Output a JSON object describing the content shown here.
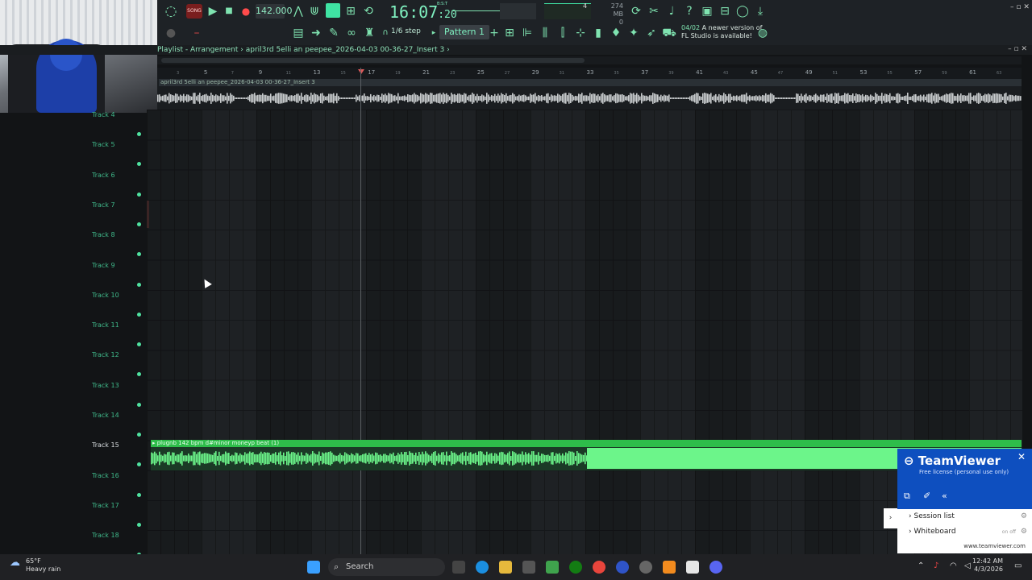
{
  "webcam": {
    "label": "webcam-overlay"
  },
  "toolbar": {
    "song_label": "SONG",
    "tempo": "142.000",
    "clock": "16:07",
    "clock_sub": ":20",
    "clock_tag": "B:S:T",
    "mem_top": "274 MB",
    "mem_bottom": "0",
    "cpu_num": "4",
    "step": "1/6 step",
    "pattern": "Pattern 1",
    "update_date": "04/02",
    "update_line1": "A newer version of",
    "update_line2": "FL Studio is available!"
  },
  "playlist": {
    "title": "Playlist - Arrangement",
    "sep": "›",
    "file": "april3rd 5elli an peepee_2026-04-03 00-36-27_Insert 3",
    "ctrl": "– ▫ ✕"
  },
  "ruler": {
    "major": [
      "3",
      "5",
      "7",
      "9",
      "11",
      "13",
      "15",
      "17",
      "19",
      "21",
      "23",
      "25",
      "27",
      "29",
      "31",
      "33",
      "35",
      "37",
      "39",
      "41",
      "43",
      "45",
      "47",
      "49",
      "51",
      "53",
      "55",
      "57",
      "59",
      "61",
      "63"
    ]
  },
  "top_clip": {
    "label": "april3rd 5elli an peepee_2026-04-03 00-36-27_Insert 3"
  },
  "tracks": [
    "Track 4",
    "Track 5",
    "Track 6",
    "Track 7",
    "Track 8",
    "Track 9",
    "Track 10",
    "Track 11",
    "Track 12",
    "Track 13",
    "Track 14",
    "Track 15",
    "Track 16",
    "Track 17",
    "Track 18"
  ],
  "green_clip": {
    "label": "▸ plugnb 142 bpm d#minor moneyp beat (1)",
    "color": "#2ebd4a"
  },
  "teamviewer": {
    "title": "TeamViewer",
    "subtitle": "Free license (personal use only)",
    "close": "✕",
    "session": "Session list",
    "whiteboard": "Whiteboard",
    "wb_state_on": "on",
    "wb_state_off": "off",
    "url": "www.teamviewer.com"
  },
  "taskbar": {
    "temp": "65°F",
    "weather": "Heavy rain",
    "search": "Search",
    "time": "12:42 AM",
    "date": "4/3/2026"
  }
}
